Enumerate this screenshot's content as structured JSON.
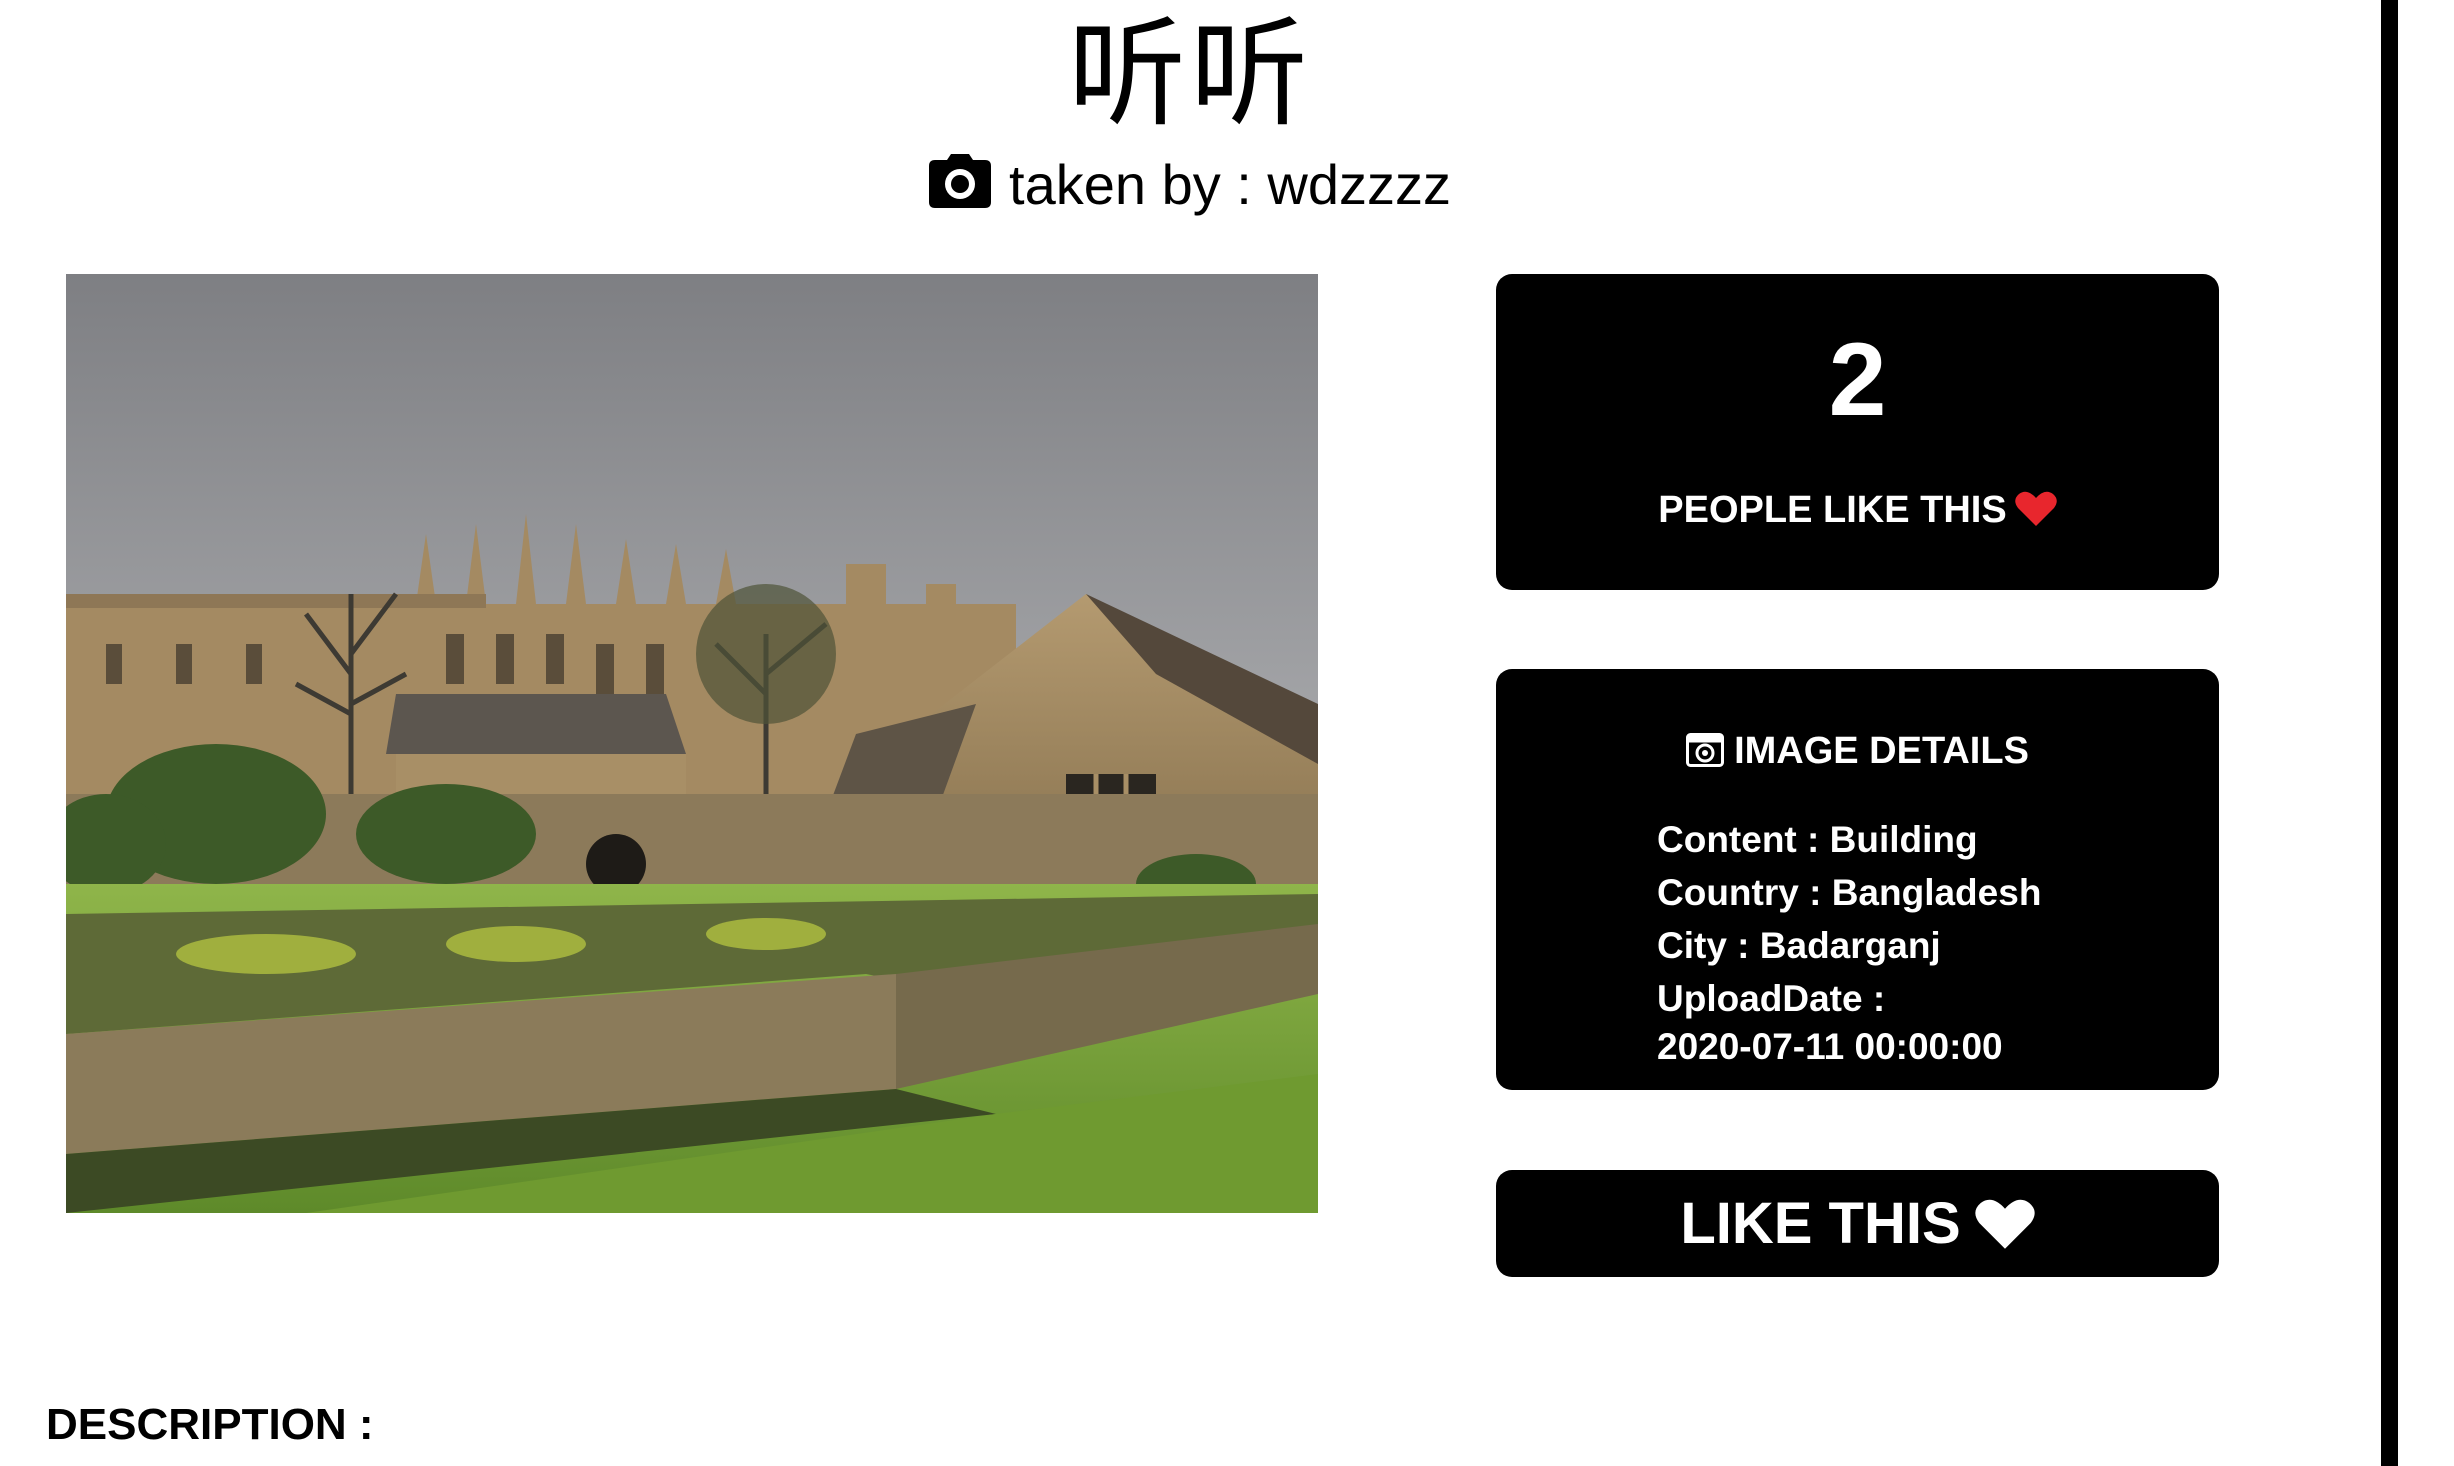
{
  "page": {
    "title": "听听",
    "byline": "taken by : wdzzzz",
    "description_label": "DESCRIPTION :"
  },
  "photo": {
    "alt": "Stone college buildings with gothic spires behind a green lawn"
  },
  "likes": {
    "count": "2",
    "label": "PEOPLE LIKE THIS"
  },
  "details": {
    "title": "IMAGE DETAILS",
    "content": "Content : Building",
    "country": "Country : Bangladesh",
    "city": "City : Badarganj",
    "upload_label": "UploadDate :",
    "upload_value": "2020-07-11 00:00:00"
  },
  "like_button": {
    "label": "LIKE THIS"
  },
  "colors": {
    "heart": "#e8262d",
    "card_bg": "#000000",
    "card_text": "#ffffff"
  },
  "icons": {
    "camera": "camera-icon",
    "heart": "heart-icon",
    "image": "image-icon"
  }
}
